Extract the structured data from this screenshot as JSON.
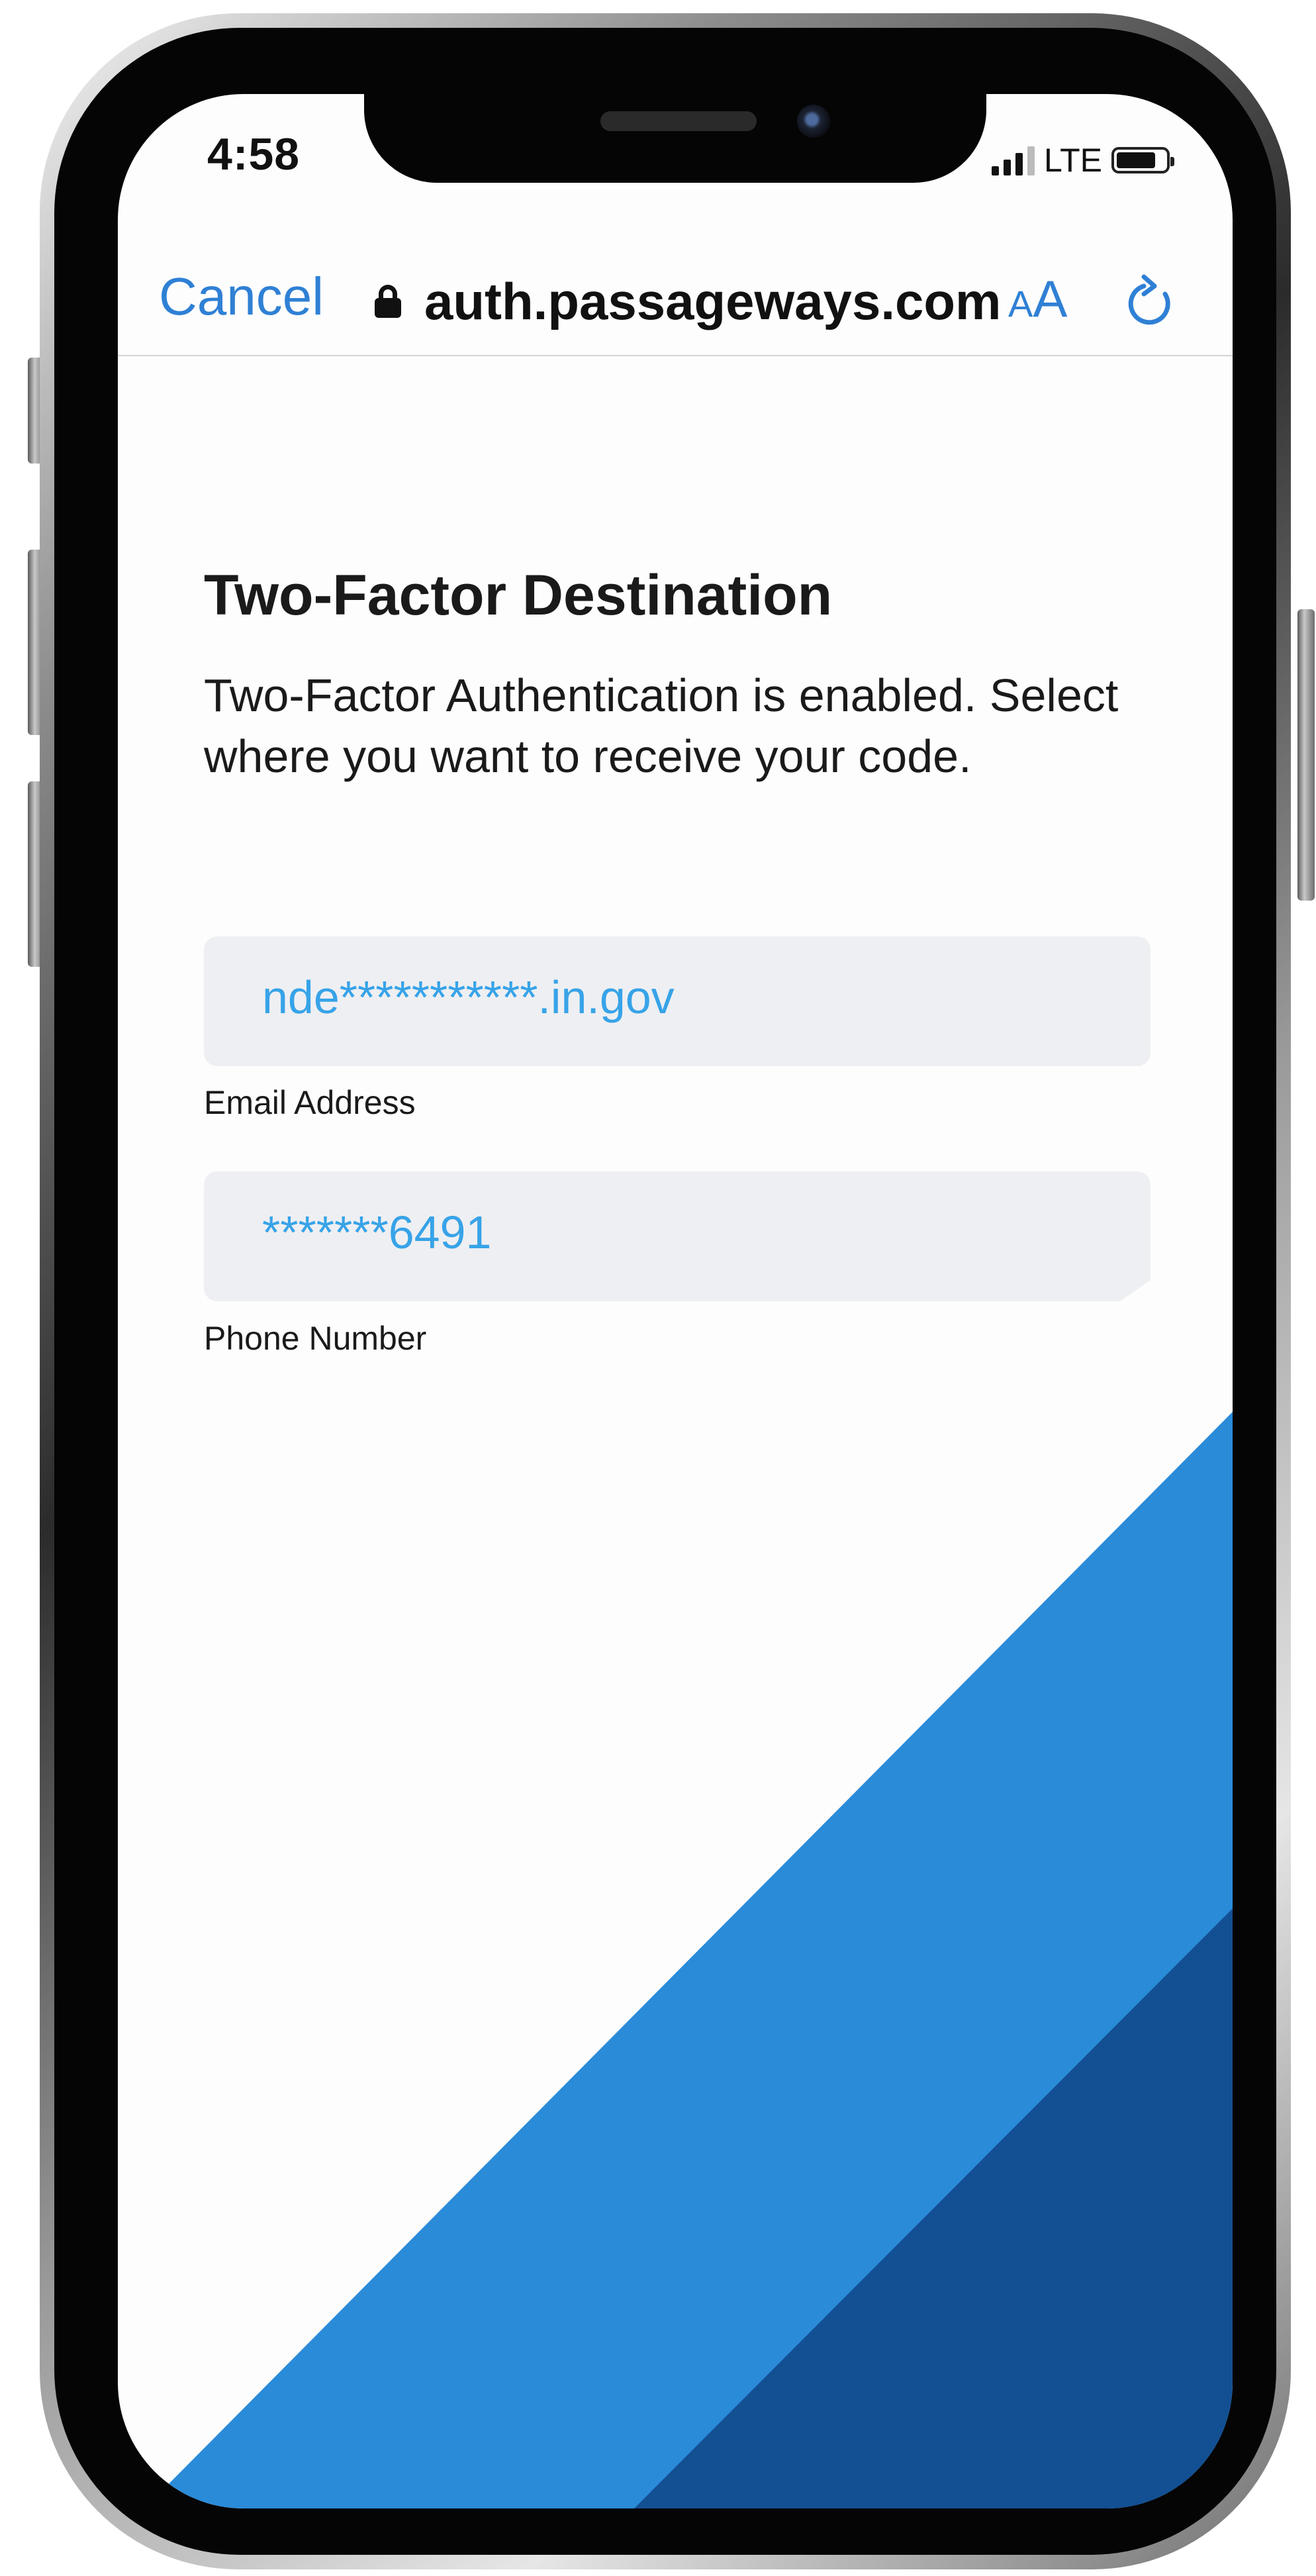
{
  "status_bar": {
    "time": "4:58",
    "network": "LTE",
    "signal_bars": 4,
    "icons": [
      "signal-icon",
      "battery-icon"
    ]
  },
  "browser": {
    "cancel_label": "Cancel",
    "url": "auth.passageways.com",
    "text_size_small": "A",
    "text_size_large": "A",
    "icons": [
      "lock-icon",
      "reload-icon"
    ],
    "accent_color": "#2f80d5"
  },
  "page": {
    "title": "Two-Factor Destination",
    "description": "Two-Factor Authentication is enabled. Select where you want to receive your code.",
    "options": [
      {
        "value": "nde***********.in.gov",
        "label": "Email Address"
      },
      {
        "value": "*******6491",
        "label": "Phone Number"
      }
    ],
    "value_color": "#37a3e8",
    "field_background": "#eeeff2"
  },
  "decor_colors": {
    "light_blue": "#2a8bd9",
    "dark_blue": "#134f93"
  }
}
